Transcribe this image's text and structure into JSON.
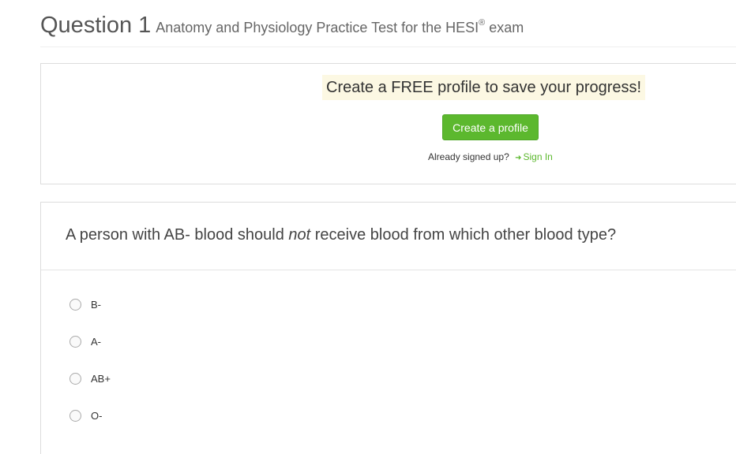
{
  "header": {
    "question_label": "Question 1",
    "subtitle_main": "Anatomy and Physiology Practice Test for the HESI",
    "subtitle_reg": "®",
    "subtitle_end": " exam"
  },
  "promo": {
    "headline": "Create a FREE profile to save your progress!",
    "button_label": "Create a profile",
    "already_text": "Already signed up?",
    "signin_icon": "sign-in-icon",
    "signin_label": "Sign In",
    "accent_color": "#5cb82e",
    "highlight_color": "#fcf8e3"
  },
  "question": {
    "text_before": "A person with AB- blood should ",
    "text_emphasis": "not",
    "text_after": " receive blood from which other blood type?",
    "options": [
      {
        "label": "B-"
      },
      {
        "label": "A-"
      },
      {
        "label": "AB+"
      },
      {
        "label": "O-"
      }
    ]
  }
}
